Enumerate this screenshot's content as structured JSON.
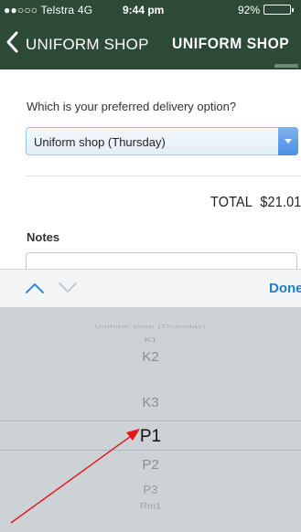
{
  "status_bar": {
    "carrier": "●●○○○ Telstra  4G",
    "time": "9:44 pm",
    "battery": "92%",
    "battery_level": 0.92
  },
  "nav": {
    "back_icon": "chevron-left-icon",
    "title_regular": "UNIFORM SHOP",
    "title_bold": "UNIFORM SHOP"
  },
  "form": {
    "delivery_question": "Which is your preferred delivery option?",
    "delivery_selected": "Uniform shop (Thursday)",
    "total_label": "TOTAL",
    "total_value": "$21.01",
    "notes_label": "Notes",
    "notes_value": ""
  },
  "picker_toolbar": {
    "prev_icon": "chevron-up-icon",
    "next_icon": "chevron-down-icon",
    "done_label": "Done"
  },
  "picker": {
    "items": [
      "Uniform shop (Thursday)",
      "K1",
      "K2",
      "K3",
      "P1",
      "P2",
      "P3",
      "Rm1"
    ],
    "selected": "P1"
  },
  "colors": {
    "header_bg": "#2d4a37",
    "accent": "#1d7fd8",
    "annotation": "#e8141c"
  }
}
